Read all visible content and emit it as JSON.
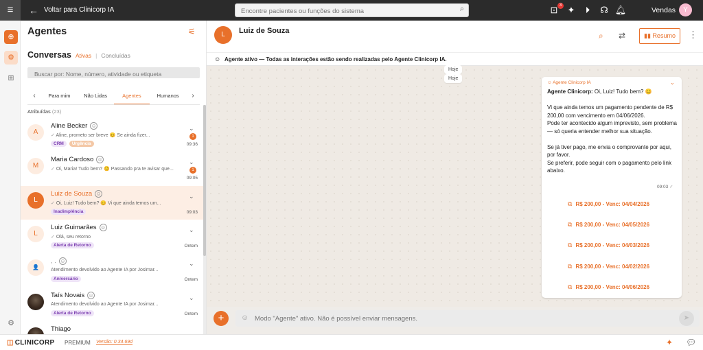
{
  "topbar": {
    "back_label": "Voltar para Clinicorp IA",
    "search_placeholder": "Encontre pacientes ou funções do sistema",
    "notif_count": "3",
    "user": "Vendas",
    "user_initial": "Y"
  },
  "left": {
    "title": "Agentes",
    "conversas": "Conversas",
    "ativas": "Ativas",
    "sep": "|",
    "concluidas": "Concluídas",
    "search_placeholder": "Buscar por: Nome, número, atividade ou etiqueta",
    "tabs": [
      "Para mim",
      "Não Lidas",
      "Agentes",
      "Humanos"
    ],
    "atribuidas": "Atribuídas",
    "atribuidas_count": "(23)",
    "items": [
      {
        "initial": "A",
        "name": "Aline Becker",
        "preview": "Aline, prometo ser breve 😊 Se ainda fizer...",
        "tags": [
          "CRM",
          "Urgência"
        ],
        "badge": "1",
        "time": "09:36"
      },
      {
        "initial": "M",
        "name": "Maria Cardoso",
        "preview": "Oi, Maria! Tudo bem? 😊 Passando pra te avisar que...",
        "tags": [],
        "badge": "1",
        "time": "09:05"
      },
      {
        "initial": "L",
        "name": "Luiz de Souza",
        "preview": "Oi, Luiz! Tudo bem? 😊 Vi que ainda temos um...",
        "tags": [
          "Inadimplência"
        ],
        "time": "09:03"
      },
      {
        "initial": "L",
        "name": "Luiz Guimarães",
        "preview": "Olá, seu retorno",
        "tags": [
          "Alerta de Retorno"
        ],
        "time": "Ontem"
      },
      {
        "initial": "👤",
        "name": ", .",
        "preview": "Atendimento devolvido ao Agente IA por Josimar...",
        "tags": [
          "Aniversário"
        ],
        "time": "Ontem"
      },
      {
        "initial": "",
        "name": "Taís Novais",
        "preview": "Atendimento devolvido ao Agente IA por Josimar...",
        "tags": [
          "Alerta de Retorno"
        ],
        "time": "Ontem"
      },
      {
        "initial": "",
        "name": "Thiago",
        "preview": "",
        "tags": [],
        "time": ""
      }
    ]
  },
  "chat": {
    "contact_initial": "L",
    "contact_name": "Luiz de Souza",
    "resumo": "Resumo",
    "banner": "Agente ativo — Todas as interações estão sendo realizadas pelo Agente Clinicorp IA.",
    "day1": "Hoje",
    "day2": "Hoje",
    "agent_label": "Agente Clinicorp IA",
    "msg_lead": "Agente Clinicorp:",
    "msg_greet": " Oi, Luiz! Tudo bem? 😊",
    "msg_p2": "Vi que ainda temos um pagamento pendente de R$ 200,00 com vencimento em 04/06/2026.",
    "msg_p2b": "Pode ter acontecido algum imprevisto, sem problema — só queria entender melhor sua situação.",
    "msg_p3": "Se já tiver pago, me envia o comprovante por aqui, por favor.",
    "msg_p3b": "Se preferir, pode seguir com o pagamento pelo link abaixo.",
    "msg_time": "09:03",
    "payments": [
      "R$ 200,00 - Venc: 04/04/2026",
      "R$ 200,00 - Venc: 04/05/2026",
      "R$ 200,00 - Venc: 04/03/2026",
      "R$ 200,00 - Venc: 04/02/2026",
      "R$ 200,00 - Venc: 04/06/2026"
    ],
    "composer_placeholder": "Modo \"Agente\" ativo. Não é possível enviar mensagens."
  },
  "footer": {
    "logo": "CLINICORP",
    "premium": "PREMIUM",
    "version": "Versão: 0.34.69d"
  },
  "colors": {
    "accent": "#e8702a",
    "topbar": "#2b2b2b",
    "tag_purple": "#7b3fb0"
  }
}
